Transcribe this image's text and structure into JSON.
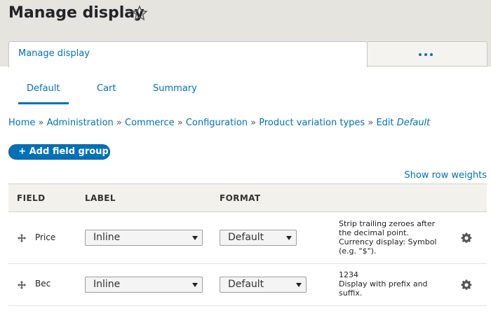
{
  "page": {
    "title": "Manage display"
  },
  "primary_tabs": {
    "active_label": "Manage display"
  },
  "secondary_tabs": [
    "Default",
    "Cart",
    "Summary"
  ],
  "breadcrumb": {
    "items": [
      "Home",
      "Administration",
      "Commerce",
      "Configuration",
      "Product variation types",
      "Edit"
    ],
    "current_italic": "Default",
    "separator": "»"
  },
  "actions": {
    "add_field_group": "+ Add field group",
    "show_row_weights": "Show row weights"
  },
  "table": {
    "headers": [
      "FIELD",
      "LABEL",
      "FORMAT"
    ],
    "rows": [
      {
        "field": "Price",
        "label_value": "Inline",
        "format_value": "Default",
        "summary": [
          "Strip trailing zeroes after",
          "the decimal point.",
          "Currency display: Symbol",
          "(e.g. \"$\")."
        ]
      },
      {
        "field": "Bec",
        "label_value": "Inline",
        "format_value": "Default",
        "summary": [
          "1234",
          "Display with prefix and",
          "suffix."
        ]
      }
    ]
  },
  "colors": {
    "link": "#0071b8",
    "header_band": "#e6e4df",
    "button": "#0071b8"
  }
}
